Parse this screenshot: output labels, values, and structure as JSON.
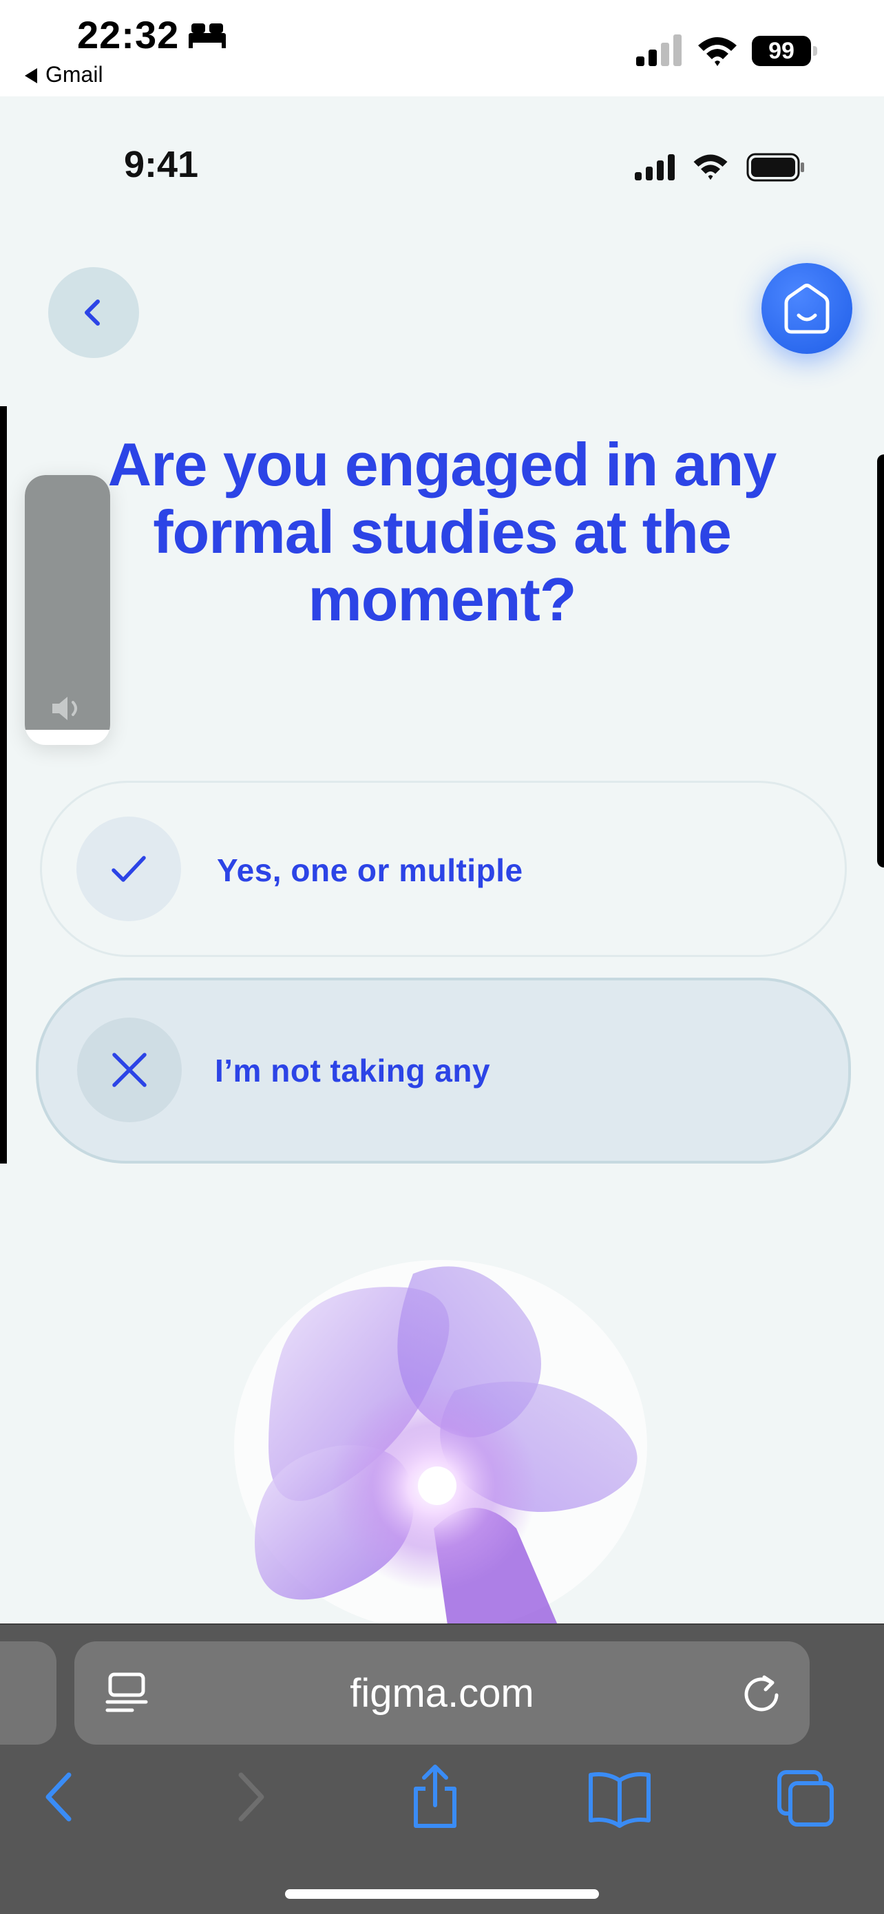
{
  "system_status": {
    "time": "22:32",
    "back_app": "Gmail",
    "battery": "99"
  },
  "inner_status": {
    "time": "9:41"
  },
  "survey": {
    "question": "Are you engaged in any formal studies at the moment?",
    "options": [
      {
        "label": "Yes, one or multiple",
        "icon": "check-icon",
        "selected": false
      },
      {
        "label": "I’m not taking any",
        "icon": "x-icon",
        "selected": true
      }
    ]
  },
  "browser": {
    "url": "figma.com"
  },
  "colors": {
    "accent": "#2c44e6",
    "background": "#f1f6f6",
    "browser_bar": "#575757",
    "home_button": "#2a6af2"
  }
}
